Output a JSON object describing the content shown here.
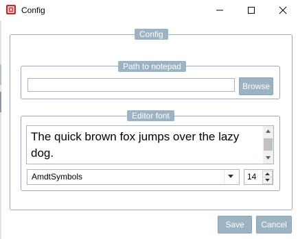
{
  "window": {
    "title": "Config",
    "controls": {
      "minimize_icon": "minimize-icon",
      "maximize_icon": "maximize-icon",
      "close_icon": "close-icon"
    }
  },
  "config_group": {
    "label": "Config"
  },
  "path_group": {
    "label": "Path to notepad",
    "path_value": "",
    "browse_label": "Browse"
  },
  "font_group": {
    "label": "Editor font",
    "preview_text": "The quick brown fox jumps over the lazy dog.",
    "font_name": "AmdtSymbols",
    "font_size": "14"
  },
  "footer": {
    "save_label": "Save",
    "cancel_label": "Cancel"
  },
  "colors": {
    "accent": "#9cb3c4",
    "border": "#9aaab8",
    "app_icon": "#c8262b"
  }
}
